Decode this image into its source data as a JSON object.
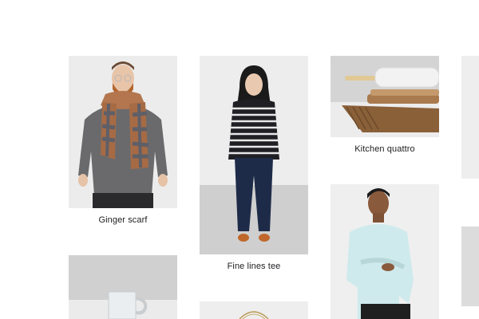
{
  "gallery": {
    "products": [
      {
        "name": "Ginger scarf",
        "image_icon": "man-with-plaid-scarf-photo"
      },
      {
        "name": "Fine lines tee",
        "image_icon": "woman-in-striped-tee-photo"
      },
      {
        "name": "Kitchen quattro",
        "image_icon": "rolling-pin-and-boards-photo"
      },
      {
        "name": "",
        "image_icon": "man-in-mint-sweater-photo"
      },
      {
        "name": "",
        "image_icon": "white-mug-photo"
      },
      {
        "name": "",
        "image_icon": "gold-wire-item-photo"
      },
      {
        "name": "",
        "image_icon": "offscreen-product-photo"
      },
      {
        "name": "",
        "image_icon": "offscreen-product-photo"
      }
    ]
  },
  "colors": {
    "photo_background": "#eeeeee",
    "label_text": "#202124"
  }
}
